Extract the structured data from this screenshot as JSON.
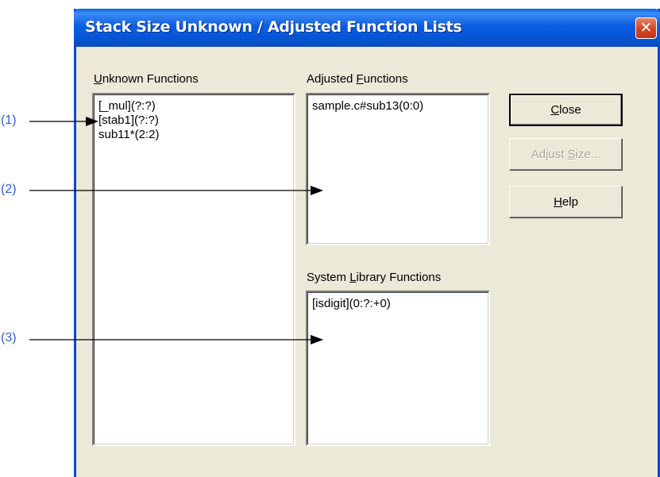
{
  "window": {
    "title": "Stack Size Unknown / Adjusted Function Lists",
    "close_glyph": "✕"
  },
  "unknown": {
    "label_prefix": "",
    "label_accel": "U",
    "label_rest": "nknown Functions",
    "items": [
      "[_mul](?:?)",
      "[stab1](?:?)",
      "sub11*(2:2)"
    ]
  },
  "adjusted": {
    "label_prefix": "Adjusted ",
    "label_accel": "F",
    "label_rest": "unctions",
    "items": [
      "sample.c#sub13(0:0)"
    ]
  },
  "syslib": {
    "label_prefix": "System ",
    "label_accel": "L",
    "label_rest": "ibrary Functions",
    "items": [
      "[isdigit](0:?:+0)"
    ]
  },
  "buttons": {
    "close": {
      "accel": "C",
      "rest": "lose"
    },
    "adjust": {
      "prefix": "Adjust ",
      "accel": "S",
      "rest": "ize..."
    },
    "help": {
      "accel": "H",
      "rest": "elp"
    }
  },
  "callouts": [
    "(1)",
    "(2)",
    "(3)"
  ]
}
